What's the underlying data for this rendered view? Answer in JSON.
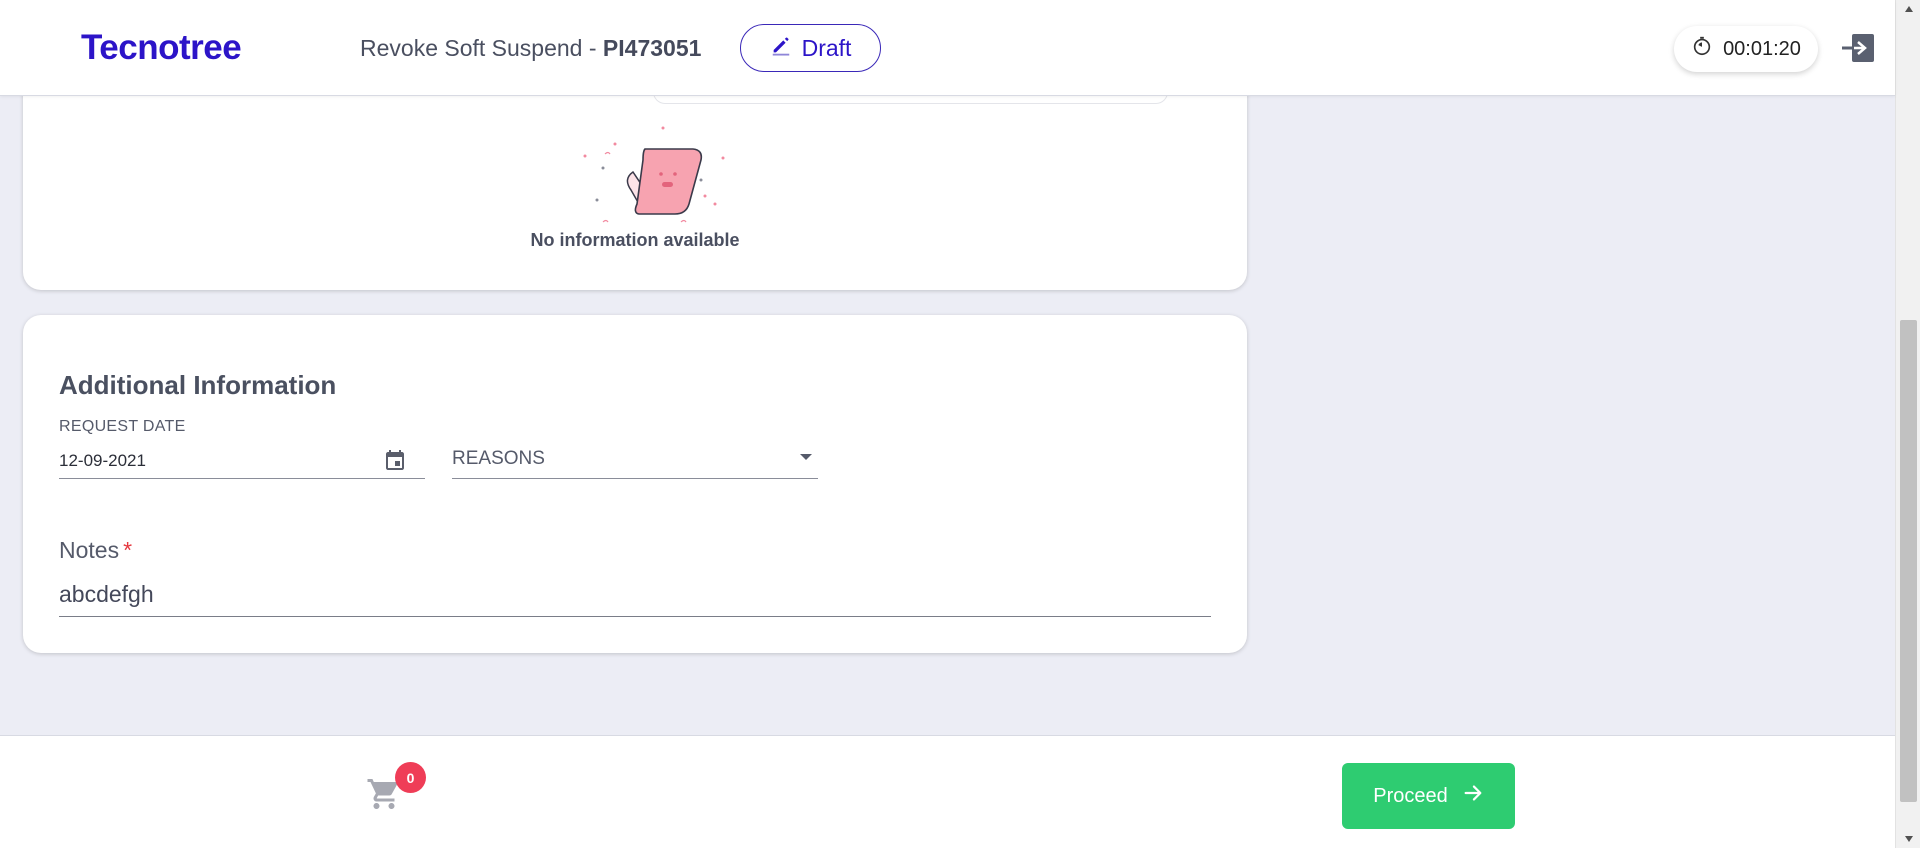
{
  "header": {
    "logo": "Tecnotree",
    "title_prefix": "Revoke Soft Suspend - ",
    "title_id": "PI473051",
    "draft_label": "Draft",
    "timer": "00:01:20"
  },
  "top_card": {
    "empty_message": "No information available"
  },
  "additional_info": {
    "title": "Additional Information",
    "request_date_label": "REQUEST DATE",
    "request_date_value": "12-09-2021",
    "reasons_placeholder": "REASONS",
    "notes_label": "Notes",
    "notes_required": "*",
    "notes_value": "abcdefgh"
  },
  "footer": {
    "cart_count": "0",
    "proceed_label": "Proceed"
  },
  "colors": {
    "brand": "#2c14c8",
    "proceed": "#2ecc71",
    "badge": "#ef3d57",
    "background": "#ecedf5"
  },
  "icons": {
    "draft": "pencil-icon",
    "timer": "stopwatch-icon",
    "logout": "logout-icon",
    "calendar": "calendar-icon",
    "dropdown": "caret-down-icon",
    "cart": "cart-icon",
    "proceed": "arrow-right-icon"
  }
}
